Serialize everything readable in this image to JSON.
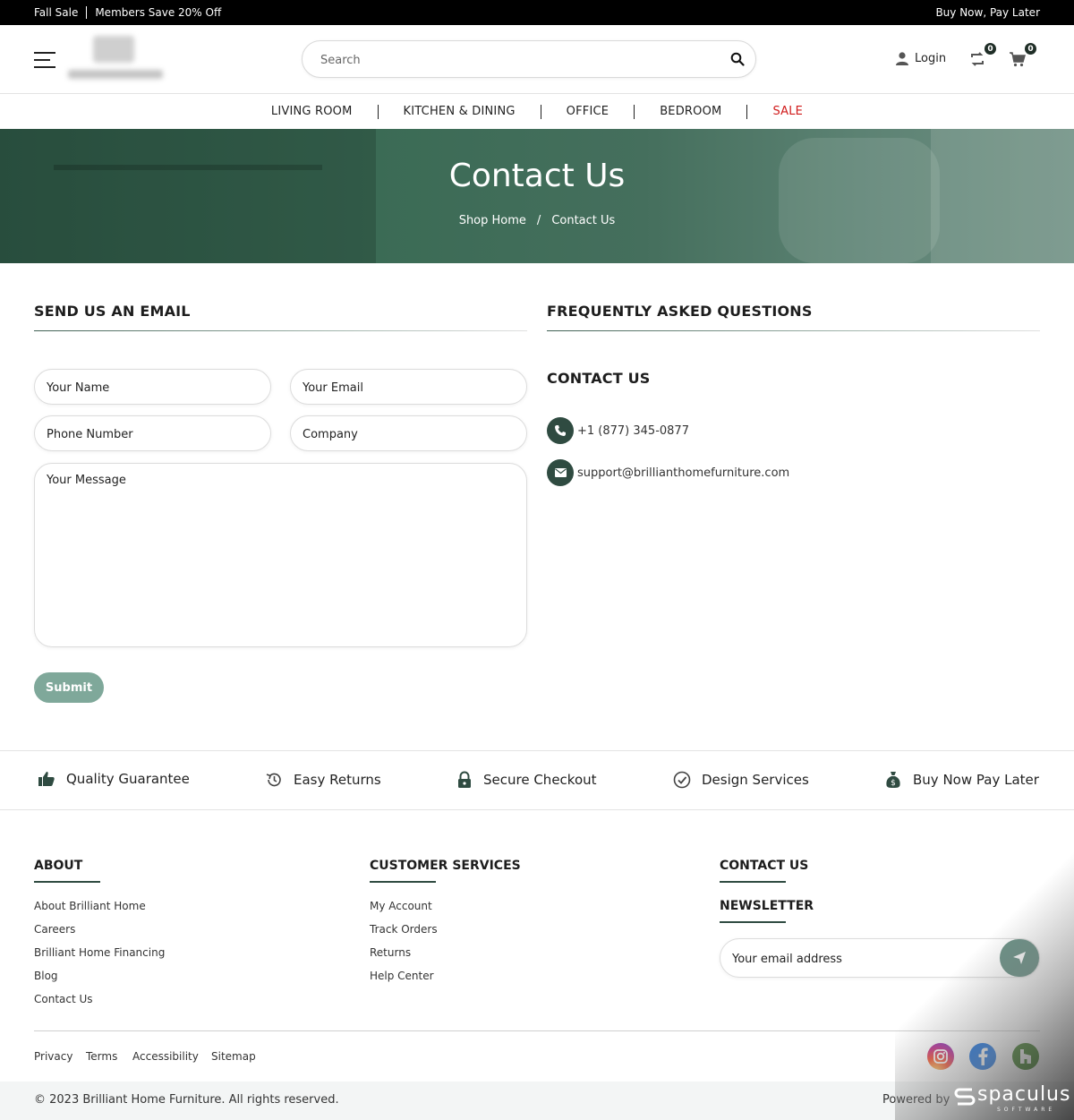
{
  "topbar": {
    "sale": "Fall Sale",
    "members": "Members Save 20% Off",
    "bnpl": "Buy Now, Pay Later"
  },
  "header": {
    "search_placeholder": "Search",
    "login": "Login",
    "compare_count": "0",
    "cart_count": "0"
  },
  "nav": {
    "items": [
      "LIVING ROOM",
      "KITCHEN & DINING",
      "OFFICE",
      "BEDROOM",
      "SALE"
    ],
    "sale_color": "#d01a1a"
  },
  "hero": {
    "title": "Contact Us",
    "breadcrumb": [
      "Shop Home",
      "/",
      "Contact Us"
    ]
  },
  "form": {
    "title": "SEND US AN EMAIL",
    "name_placeholder": "Your Name",
    "email_placeholder": "Your Email",
    "phone_placeholder": "Phone Number",
    "company_placeholder": "Company",
    "message_placeholder": "Your Message",
    "submit": "Submit"
  },
  "faq": {
    "title": "FREQUENTLY ASKED QUESTIONS",
    "contact_title": "CONTACT US",
    "phone": "+1 (877) 345-0877",
    "email": "support@brillianthomefurniture.com"
  },
  "features": [
    {
      "label": "Quality Guarantee",
      "icon": "thumbs-up-icon"
    },
    {
      "label": "Easy Returns",
      "icon": "history-icon"
    },
    {
      "label": "Secure Checkout",
      "icon": "lock-icon"
    },
    {
      "label": "Design Services",
      "icon": "check-circle-icon"
    },
    {
      "label": "Buy Now Pay Later",
      "icon": "money-bag-icon"
    }
  ],
  "footer": {
    "about_title": "ABOUT",
    "about_links": [
      "About Brilliant Home",
      "Careers",
      "Brilliant Home Financing",
      "Blog",
      "Contact Us"
    ],
    "cs_title": "CUSTOMER SERVICES",
    "cs_links": [
      "My Account",
      "Track Orders",
      "Returns",
      "Help Center"
    ],
    "contact_title": "CONTACT US",
    "newsletter_title": "NEWSLETTER",
    "newsletter_placeholder": "Your email address",
    "legal": [
      "Privacy",
      "Terms",
      "Accessibility",
      "Sitemap"
    ],
    "copyright": "© 2023 Brilliant Home Furniture. All rights reserved.",
    "powered_by": "Powered by",
    "powered_brand": "spaculus",
    "powered_brand_sub": "SOFTWARE"
  },
  "colors": {
    "accent": "#2f4b41",
    "submit": "#7fa89a",
    "hero": "#3b6b55"
  }
}
